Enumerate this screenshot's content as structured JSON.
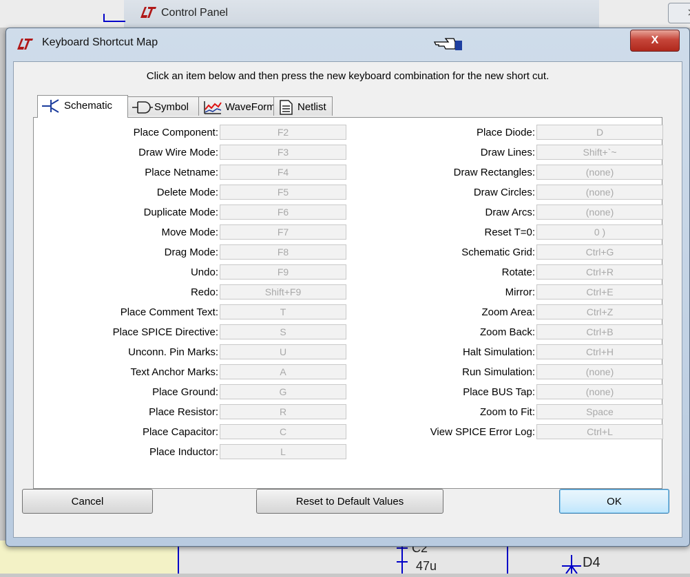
{
  "background": {
    "control_panel_title": "Control Panel",
    "control_panel_close": "ᐯ",
    "schematic_labels": [
      "C2",
      "47u",
      "D4"
    ]
  },
  "dialog": {
    "title": "Keyboard Shortcut Map",
    "close_label": "X",
    "instruction": "Click an item below and then press the new keyboard combination for the new short cut.",
    "tabs": [
      {
        "label": "Schematic",
        "active": true
      },
      {
        "label": "Symbol",
        "active": false
      },
      {
        "label": "WaveForm",
        "active": false
      },
      {
        "label": "Netlist",
        "active": false
      }
    ],
    "left_shortcuts": [
      {
        "label": "Place Component:",
        "value": "F2"
      },
      {
        "label": "Draw Wire Mode:",
        "value": "F3"
      },
      {
        "label": "Place Netname:",
        "value": "F4"
      },
      {
        "label": "Delete Mode:",
        "value": "F5"
      },
      {
        "label": "Duplicate Mode:",
        "value": "F6"
      },
      {
        "label": "Move Mode:",
        "value": "F7"
      },
      {
        "label": "Drag Mode:",
        "value": "F8"
      },
      {
        "label": "Undo:",
        "value": "F9"
      },
      {
        "label": "Redo:",
        "value": "Shift+F9"
      },
      {
        "label": "Place Comment Text:",
        "value": "T"
      },
      {
        "label": "Place SPICE Directive:",
        "value": "S"
      },
      {
        "label": "Unconn. Pin Marks:",
        "value": "U"
      },
      {
        "label": "Text Anchor Marks:",
        "value": "A"
      },
      {
        "label": "Place Ground:",
        "value": "G"
      },
      {
        "label": "Place Resistor:",
        "value": "R"
      },
      {
        "label": "Place Capacitor:",
        "value": "C"
      },
      {
        "label": "Place Inductor:",
        "value": "L"
      }
    ],
    "right_shortcuts": [
      {
        "label": "Place Diode:",
        "value": "D"
      },
      {
        "label": "Draw Lines:",
        "value": "Shift+`~"
      },
      {
        "label": "Draw Rectangles:",
        "value": "(none)"
      },
      {
        "label": "Draw Circles:",
        "value": "(none)"
      },
      {
        "label": "Draw Arcs:",
        "value": "(none)"
      },
      {
        "label": "Reset T=0:",
        "value": "0 )"
      },
      {
        "label": "Schematic Grid:",
        "value": "Ctrl+G"
      },
      {
        "label": "Rotate:",
        "value": "Ctrl+R"
      },
      {
        "label": "Mirror:",
        "value": "Ctrl+E"
      },
      {
        "label": "Zoom Area:",
        "value": "Ctrl+Z"
      },
      {
        "label": "Zoom Back:",
        "value": "Ctrl+B"
      },
      {
        "label": "Halt Simulation:",
        "value": "Ctrl+H"
      },
      {
        "label": "Run Simulation:",
        "value": "(none)"
      },
      {
        "label": "Place BUS Tap:",
        "value": "(none)"
      },
      {
        "label": "Zoom to Fit:",
        "value": "Space"
      },
      {
        "label": "View SPICE Error Log:",
        "value": "Ctrl+L"
      }
    ],
    "buttons": {
      "cancel": "Cancel",
      "reset": "Reset to Default Values",
      "ok": "OK"
    }
  }
}
